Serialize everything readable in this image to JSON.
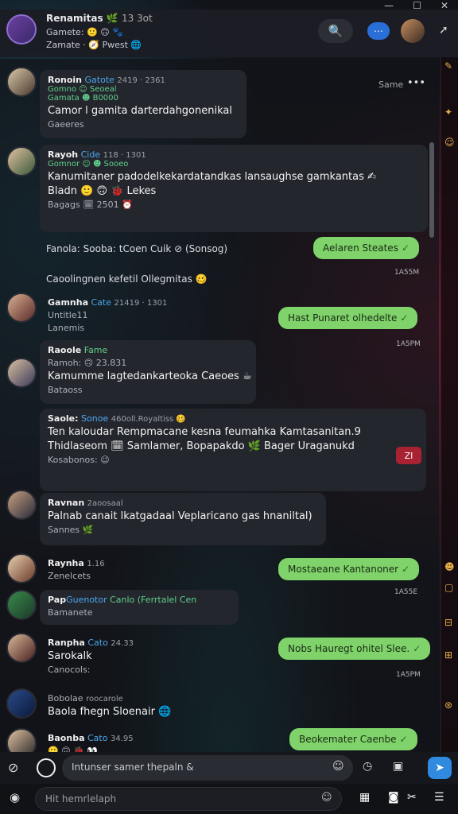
{
  "window": {
    "min": "—",
    "max": "☐",
    "close": "✕"
  },
  "header": {
    "title": "Renamitas",
    "title_suffix": "13 3ot",
    "line2": "Gamete: 🙂 🙃 🐾",
    "line3": "Zamate · 🧭 Pwest 🌐",
    "search_icon": "🔍",
    "icon2": "⋯",
    "arrow": "➚"
  },
  "messages": [
    {
      "name": "Ronoin",
      "tag": "Gatote",
      "time": "2419 · 2361",
      "line2": "Gomno   ☺ Seoeal",
      "line3": "Gamata    ☻ B0000",
      "body": "Camor l gamita darterdahgonenikal",
      "foot": "Gaeeres",
      "side_text": "Same",
      "more": "•••"
    },
    {
      "name": "Rayoh",
      "tag": "Cide",
      "time": "118 · 1301",
      "line2": "Gomnor  ☺ ☻ Sooeo",
      "body": "Kanumitaner padodelkekardatandkas lansaughse gamkantas ✍",
      "body2": "Bladn  🙂 🙃 🐞 Lekes",
      "foot": "Bagags  🗓 2501 ⏰"
    },
    {
      "name": "Gamnha",
      "tag": "Cate",
      "time": "21419 · 1301",
      "line2": "Untitle11",
      "line3": "Lanemis"
    },
    {
      "name": "Raoole",
      "tag": "Fame",
      "line2": "Ramoh: 🙃 23.831",
      "body": "Kamumme lagtedankarteoka Caeoes ☕",
      "foot": "Bataoss"
    },
    {
      "name": "Saole:",
      "tag": "Sonoe",
      "time": "460oll.Royaltiss 🥴",
      "body": "Ten kaloudar Rempmacane kesna feumahka Kamtasanitan.9",
      "body2": "Thidlaseom 🗓 Samlamer, Bopapakdo 🌿 Bager Uraganukd",
      "foot": "Kosabonos: 😉"
    },
    {
      "name": "Ravnan",
      "tag": "",
      "time": "2aoosaal",
      "body": "Palnab canait lkatgadaal Veplaricano gas hnaniltal)",
      "foot": "Sannes 🌿"
    },
    {
      "name": "Raynha",
      "tag": "",
      "time": "1.16",
      "line2": "Zenelcets"
    },
    {
      "name": "Pap",
      "tag": "Guenotor",
      "extra": "Canlo (Ferrtalel Cen",
      "line2": "Bamanete"
    },
    {
      "name": "Ranpha",
      "tag": "Cato",
      "time": "24.33",
      "line2": "Sarokalk",
      "foot": "Canocols:"
    },
    {
      "name": "Bobolae",
      "tag": "roocarole",
      "line2": "Baola fhegn Sloenair 🌐"
    },
    {
      "name": "Baonba",
      "tag": "Cato",
      "time": "34.95",
      "emojis": "🙂 🙃 🐞 👀"
    }
  ],
  "system_lines": [
    "Fanola: Sooba: tCoen Cuik ⊘ (Sonsog)",
    "Caoolingnen kefetil Ollegmitas 🥴"
  ],
  "outgoing": [
    {
      "text": "Aelaren Steates",
      "time": "1A55M"
    },
    {
      "text": "Hast Punaret olhedelte",
      "time": "1A5PM"
    },
    {
      "text": "Mostaeane Kantanoner",
      "time": "1A55E"
    },
    {
      "text": "Nobs Hauregt ohitel Slee.",
      "time": "1A5PM"
    },
    {
      "text": "Beokemater Caenbe",
      "time": ""
    }
  ],
  "badge": "ZI",
  "composer": {
    "placeholder": "Intunser samer thepaln &",
    "placeholder2": "Hit hemrlelaph"
  },
  "colors": {
    "accent": "#4aa8f0",
    "outgoing": "#7fd36a",
    "badge": "#a82232",
    "send": "#2f8ae0"
  }
}
